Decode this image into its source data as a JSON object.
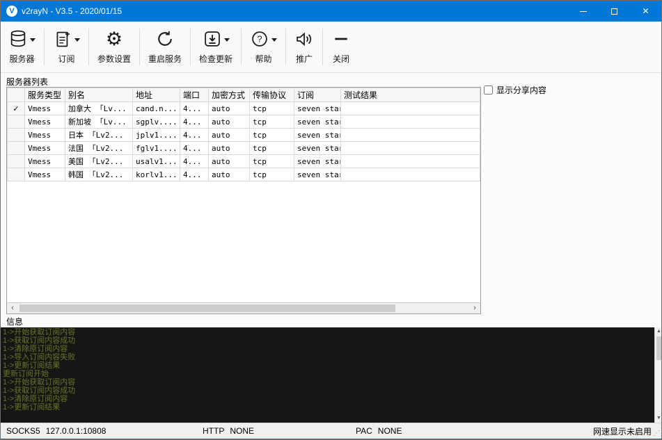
{
  "window": {
    "title": "v2rayN - V3.5 - 2020/01/15",
    "accent": "#0078d7",
    "app_letter": "V"
  },
  "toolbar": {
    "buttons": [
      {
        "label": "服务器",
        "dropdown": true
      },
      {
        "label": "订阅",
        "dropdown": true
      },
      {
        "label": "参数设置",
        "dropdown": false
      },
      {
        "label": "重启服务",
        "dropdown": false
      },
      {
        "label": "检查更新",
        "dropdown": true
      },
      {
        "label": "帮助",
        "dropdown": true
      },
      {
        "label": "推广",
        "dropdown": false
      },
      {
        "label": "关闭",
        "dropdown": false
      }
    ],
    "gear_glyph": "⚙"
  },
  "server_list": {
    "section_label": "服务器列表",
    "columns": [
      "",
      "服务类型",
      "别名",
      "地址",
      "端口",
      "加密方式",
      "传输协议",
      "订阅",
      "测试结果"
    ],
    "rows": [
      {
        "indicator": "✓",
        "type": "Vmess",
        "alias": "加拿大 「Lv...",
        "address": "cand.n...",
        "port": "4...",
        "security": "auto",
        "transport": "tcp",
        "subscription": "seven star",
        "test": ""
      },
      {
        "indicator": "",
        "type": "Vmess",
        "alias": "新加坡 「Lv...",
        "address": "sgplv....",
        "port": "4...",
        "security": "auto",
        "transport": "tcp",
        "subscription": "seven star",
        "test": ""
      },
      {
        "indicator": "",
        "type": "Vmess",
        "alias": "日本 「Lv2...",
        "address": "jplv1....",
        "port": "4...",
        "security": "auto",
        "transport": "tcp",
        "subscription": "seven star",
        "test": ""
      },
      {
        "indicator": "",
        "type": "Vmess",
        "alias": "法国 「Lv2...",
        "address": "fglv1....",
        "port": "4...",
        "security": "auto",
        "transport": "tcp",
        "subscription": "seven star",
        "test": ""
      },
      {
        "indicator": "",
        "type": "Vmess",
        "alias": "美国 「Lv2...",
        "address": "usalv1...",
        "port": "4...",
        "security": "auto",
        "transport": "tcp",
        "subscription": "seven star",
        "test": ""
      },
      {
        "indicator": "",
        "type": "Vmess",
        "alias": "韩国 「Lv2...",
        "address": "korlv1...",
        "port": "4...",
        "security": "auto",
        "transport": "tcp",
        "subscription": "seven star",
        "test": ""
      }
    ],
    "hscroll_left": "‹",
    "hscroll_right": "›"
  },
  "share_panel": {
    "checkbox_label": "显示分享内容",
    "checked": false
  },
  "info": {
    "section_label": "信息",
    "lines": [
      "1->开始获取订阅内容",
      "1->获取订阅内容成功",
      "1->清除原订阅内容",
      "1->导入订阅内容失败",
      "1->更新订阅结果",
      "更新订阅开始",
      "1->开始获取订阅内容",
      "1->获取订阅内容成功",
      "1->清除原订阅内容",
      "1->更新订阅结果"
    ],
    "scroll_up": "▲",
    "scroll_down": "▼"
  },
  "statusbar": {
    "socks_label": "SOCKS5",
    "socks_value": "127.0.0.1:10808",
    "http_label": "HTTP",
    "http_value": "NONE",
    "pac_label": "PAC",
    "pac_value": "NONE",
    "speed": "网速显示未启用",
    "grip": "⋰"
  }
}
